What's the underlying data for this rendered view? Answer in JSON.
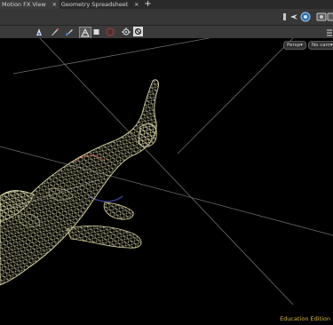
{
  "tabs": [
    {
      "label": "Motion FX View",
      "close": "✕"
    },
    {
      "label": "Geometry Spreadsheet",
      "close": "✕"
    }
  ],
  "add_tab": "+",
  "viewport": {
    "camera_mode": "Persp",
    "camera_select": "No cam",
    "edition_label": "Education Edition"
  },
  "icons": {
    "toolbar_top": [
      "pin-icon",
      "camera-icon",
      "display-options-icon",
      "snapshot-icon"
    ],
    "toolbar_shading": [
      "select-icon",
      "brush-icon",
      "paint-icon",
      "wireframe-shading-icon",
      "smooth-shading-icon",
      "hidden-icon",
      "lights-icon",
      "background-icon"
    ],
    "side": "menu-icon"
  },
  "colors": {
    "background": "#000000",
    "wireframe": "#d9d6a3",
    "grid": "#6d6d6d",
    "edition_text": "#d8b64a"
  }
}
